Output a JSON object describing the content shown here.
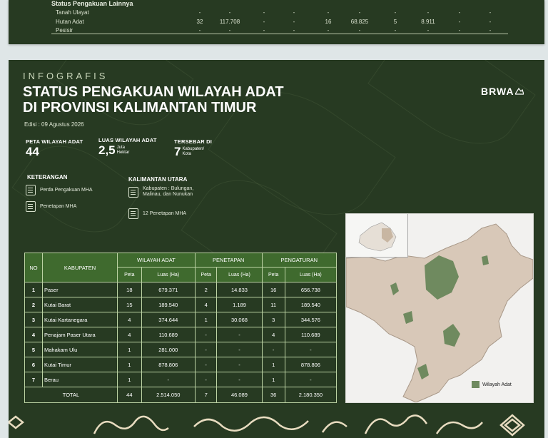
{
  "top_table": {
    "header": "Status Pengakuan Lainnya",
    "rows": [
      {
        "name": "Tanah Ulayat",
        "cells": [
          "-",
          "-",
          "-",
          "-",
          "-",
          "-",
          "-",
          "-",
          "-",
          "-"
        ]
      },
      {
        "name": "Hutan Adat",
        "cells": [
          "32",
          "117.708",
          "-",
          "-",
          "16",
          "68.825",
          "5",
          "8.911",
          "-",
          "-"
        ]
      },
      {
        "name": "Pesisir",
        "cells": [
          "-",
          "-",
          "-",
          "-",
          "-",
          "-",
          "-",
          "-",
          "-",
          "-"
        ]
      }
    ]
  },
  "header": {
    "kicker": "INFOGRAFIS",
    "title_line1": "STATUS PENGAKUAN WILAYAH ADAT",
    "title_line2": "DI PROVINSI KALIMANTAN TIMUR",
    "edition": "Edisi : 09 Agustus 2026",
    "logo": "BRWA"
  },
  "stats": {
    "peta_label": "PETA WILAYAH ADAT",
    "peta_value": "44",
    "luas_label": "LUAS WILAYAH ADAT",
    "luas_value": "2,5",
    "luas_unit1": "Juta",
    "luas_unit2": "Hektar",
    "tersebar_label": "TERSEBAR DI",
    "tersebar_value": "7",
    "tersebar_unit1": "Kabupaten/",
    "tersebar_unit2": "Kota"
  },
  "legend": {
    "heading": "KETERANGAN",
    "perda": "Perda Pengakuan MHA",
    "penetapan": "Penetapan MHA",
    "kaltara_heading": "KALIMANTAN UTARA",
    "kaltara_kab1": "Kabupaten : Bulungan,",
    "kaltara_kab2": "Malinau, dan Nunukan",
    "kaltara_penetapan": "12 Penetapan MHA"
  },
  "table": {
    "h_no": "NO",
    "h_kab": "KABUPATEN",
    "h_wilayah": "WILAYAH ADAT",
    "h_penetapan": "PENETAPAN",
    "h_pengaturan": "PENGATURAN",
    "h_peta": "Peta",
    "h_luas": "Luas (Ha)",
    "rows": [
      {
        "no": "1",
        "kab": "Paser",
        "wa_peta": "18",
        "wa_luas": "679.371",
        "pn_peta": "2",
        "pn_luas": "14.833",
        "pg_peta": "16",
        "pg_luas": "656.738"
      },
      {
        "no": "2",
        "kab": "Kutai Barat",
        "wa_peta": "15",
        "wa_luas": "189.540",
        "pn_peta": "4",
        "pn_luas": "1.189",
        "pg_peta": "11",
        "pg_luas": "189.540"
      },
      {
        "no": "3",
        "kab": "Kutai Kartanegara",
        "wa_peta": "4",
        "wa_luas": "374.644",
        "pn_peta": "1",
        "pn_luas": "30.068",
        "pg_peta": "3",
        "pg_luas": "344.576"
      },
      {
        "no": "4",
        "kab": "Penajam Paser Utara",
        "wa_peta": "4",
        "wa_luas": "110.689",
        "pn_peta": "-",
        "pn_luas": "-",
        "pg_peta": "4",
        "pg_luas": "110.689"
      },
      {
        "no": "5",
        "kab": "Mahakam Ulu",
        "wa_peta": "1",
        "wa_luas": "281.000",
        "pn_peta": "-",
        "pn_luas": "-",
        "pg_peta": "-",
        "pg_luas": "-"
      },
      {
        "no": "6",
        "kab": "Kutai Timur",
        "wa_peta": "1",
        "wa_luas": "878.806",
        "pn_peta": "-",
        "pn_luas": "-",
        "pg_peta": "1",
        "pg_luas": "878.806"
      },
      {
        "no": "7",
        "kab": "Berau",
        "wa_peta": "1",
        "wa_luas": "-",
        "pn_peta": "-",
        "pn_luas": "-",
        "pg_peta": "1",
        "pg_luas": "-"
      }
    ],
    "total": {
      "label": "TOTAL",
      "wa_peta": "44",
      "wa_luas": "2.514.050",
      "pn_peta": "7",
      "pn_luas": "46.089",
      "pg_peta": "36",
      "pg_luas": "2.180.350"
    }
  },
  "map": {
    "legend": "Wilayah Adat",
    "land_color": "#d8c8b8",
    "adat_color": "#6f8a5f"
  },
  "colors": {
    "background": "#273a22",
    "table_header": "#3f6a2e",
    "ornament": "#e8dcc0"
  }
}
